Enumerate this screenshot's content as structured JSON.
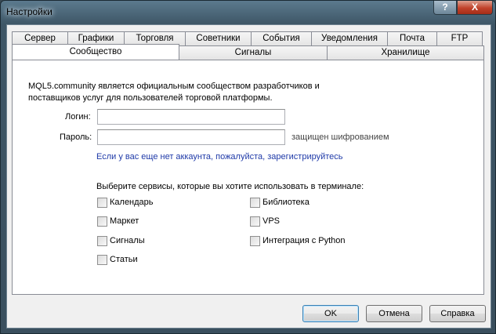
{
  "window": {
    "title": "Настройки",
    "help_label": "?",
    "close_label": "X"
  },
  "tabs_row1": [
    "Сервер",
    "Графики",
    "Торговля",
    "Советники",
    "События",
    "Уведомления",
    "Почта",
    "FTP"
  ],
  "tabs_row2": [
    "Сообщество",
    "Сигналы",
    "Хранилище"
  ],
  "active_tab": "Сообщество",
  "community": {
    "description": "MQL5.community является официальным сообществом разработчиков и поставщиков услуг для пользователей торговой платформы.",
    "login_label": "Логин:",
    "login_value": "",
    "password_label": "Пароль:",
    "password_value": "",
    "password_hint": "защищен шифрованием",
    "register_link": "Если у вас еще нет аккаунта, пожалуйста, зарегистрируйтесь",
    "services_title": "Выберите сервисы, которые вы хотите использовать в терминале:",
    "services": [
      {
        "label": "Календарь",
        "checked": false
      },
      {
        "label": "Маркет",
        "checked": false
      },
      {
        "label": "Сигналы",
        "checked": false
      },
      {
        "label": "Статьи",
        "checked": false
      },
      {
        "label": "Библиотека",
        "checked": false
      },
      {
        "label": "VPS",
        "checked": false
      },
      {
        "label": "Интеграция с Python",
        "checked": false
      }
    ]
  },
  "buttons": {
    "ok": "OK",
    "cancel": "Отмена",
    "help": "Справка"
  }
}
